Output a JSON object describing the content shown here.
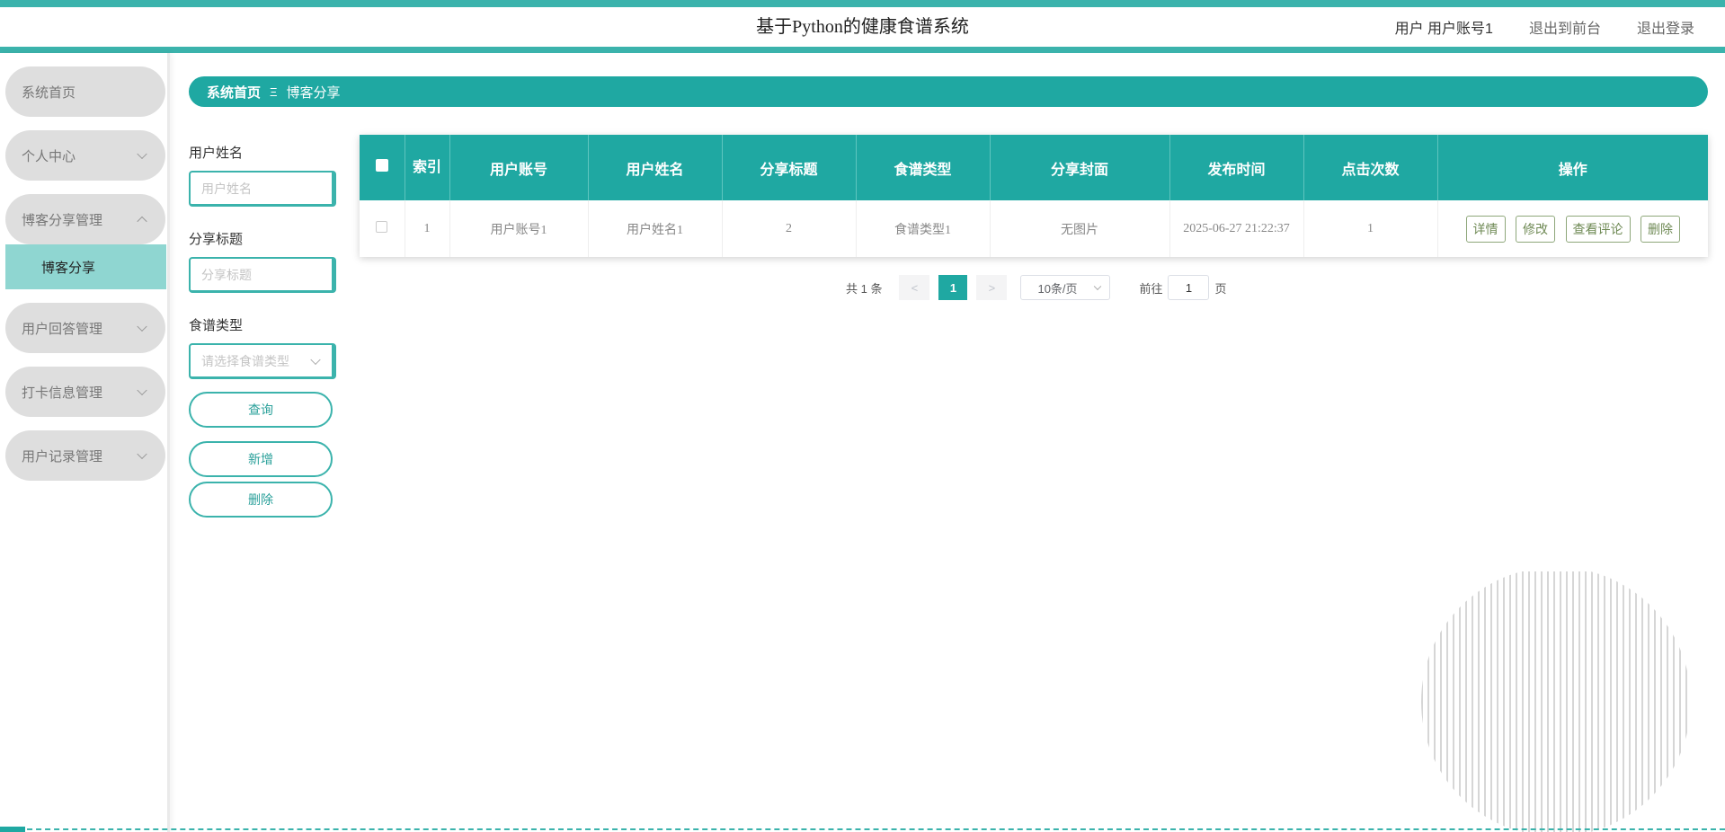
{
  "header": {
    "title": "基于Python的健康食谱系统",
    "user_label": "用户 用户账号1",
    "to_front": "退出到前台",
    "logout": "退出登录"
  },
  "sidebar": {
    "items": [
      {
        "label": "系统首页"
      },
      {
        "label": "个人中心"
      },
      {
        "label": "博客分享管理",
        "sub": "博客分享"
      },
      {
        "label": "用户回答管理"
      },
      {
        "label": "打卡信息管理"
      },
      {
        "label": "用户记录管理"
      }
    ]
  },
  "breadcrumb": {
    "home": "系统首页",
    "separator": "Ξ",
    "current": "博客分享"
  },
  "filter": {
    "username_label": "用户姓名",
    "username_placeholder": "用户姓名",
    "title_label": "分享标题",
    "title_placeholder": "分享标题",
    "type_label": "食谱类型",
    "type_placeholder": "请选择食谱类型",
    "query_btn": "查询",
    "add_btn": "新增",
    "delete_btn": "删除"
  },
  "table": {
    "headers": [
      "索引",
      "用户账号",
      "用户姓名",
      "分享标题",
      "食谱类型",
      "分享封面",
      "发布时间",
      "点击次数",
      "操作"
    ],
    "rows": [
      {
        "index": "1",
        "account": "用户账号1",
        "name": "用户姓名1",
        "title": "2",
        "type": "食谱类型1",
        "cover": "无图片",
        "time": "2025-06-27 21:22:37",
        "clicks": "1"
      }
    ],
    "actions": {
      "detail": "详情",
      "edit": "修改",
      "comments": "查看评论",
      "delete": "删除"
    }
  },
  "pagination": {
    "total": "共 1 条",
    "prev": "<",
    "current": "1",
    "next": ">",
    "page_size": "10条/页",
    "goto_prefix": "前往",
    "goto_value": "1",
    "goto_suffix": "页"
  },
  "colors": {
    "primary": "#1fa8a2",
    "accent": "#3bb3ac",
    "submenu": "#8fd6d1"
  }
}
